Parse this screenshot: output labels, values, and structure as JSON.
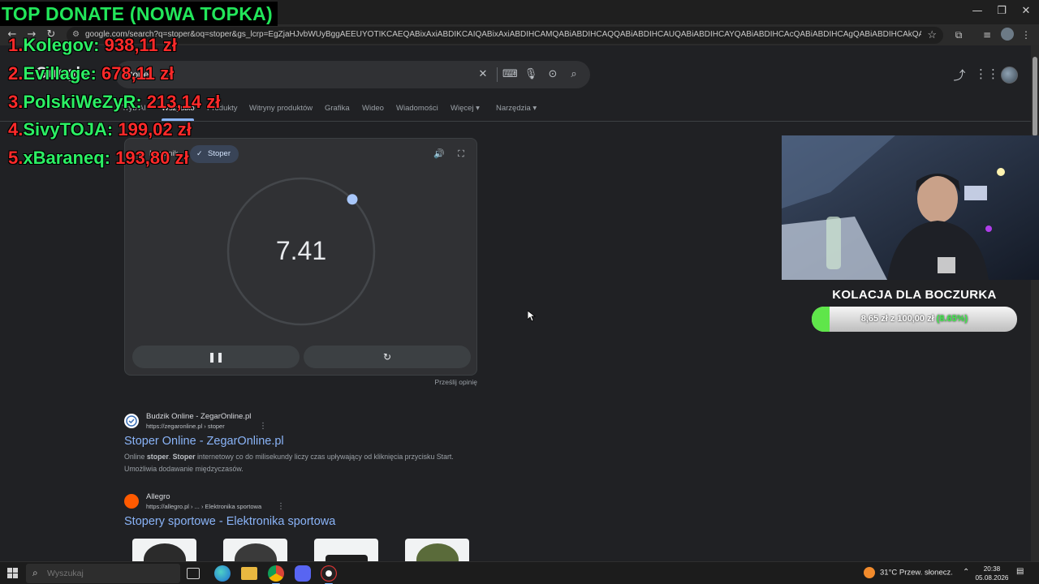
{
  "browser": {
    "url": "google.com/search?q=stoper&oq=stoper&gs_lcrp=EgZjaHJvbWUyBggAEEUYOTIKCAEQABixAxiABDIKCAIQABixAxiABDIHCAMQABiABDIHCAQQABiABDIHCAUQABiABDIHCAYQABiABDIHCAcQABiABDIHCAgQABiABDIHCAkQABiPAtIBBzYxOGowajeoAg..."
  },
  "google": {
    "logo_text": "Google",
    "search_value": "stoper",
    "tabs": [
      "Tryb AI",
      "Wszystko",
      "Produkty",
      "Witryny produktów",
      "Grafika",
      "Wideo",
      "Wiadomości",
      "Więcej ▾",
      "Narzędzia ▾"
    ],
    "stopwatch": {
      "chip_timer": "Minutnik",
      "chip_stopwatch": "Stoper",
      "time": "7.41",
      "feedback": "Prześlij opinię"
    },
    "results": [
      {
        "site": "Budzik Online - ZegarOnline.pl",
        "url": "https://zegaronline.pl › stoper",
        "title": "Stoper Online - ZegarOnline.pl",
        "snippet_a": "Online ",
        "snippet_b1": "stoper",
        "snippet_c": ". ",
        "snippet_b2": "Stoper",
        "snippet_d": " internetowy co do milisekundy liczy czas upływający od kliknięcia przycisku Start. Umożliwia dodawanie międzyczasów."
      },
      {
        "site": "Allegro",
        "url": "https://allegro.pl › ... › Elektronika sportowa",
        "title": "Stopery sportowe - Elektronika sportowa"
      }
    ]
  },
  "overlay": {
    "donate_title": "TOP DONATE (NOWA TOPKA)",
    "donors": [
      {
        "rank": "1.",
        "name": "Kolegov",
        "amount": "938,11 zł"
      },
      {
        "rank": "2.",
        "name": "Evillage",
        "amount": "678,11 zł"
      },
      {
        "rank": "3.",
        "name": "PolskiWeZyR",
        "amount": "213,14 zł"
      },
      {
        "rank": "4.",
        "name": "SivyTOJA",
        "amount": "199,02 zł"
      },
      {
        "rank": "5.",
        "name": "xBaraneq",
        "amount": "193,80 zł"
      }
    ],
    "goal": {
      "title": "KOLACJA DLA BOCZURKA",
      "amount_text": "8,65 zł z 100,00 zł",
      "percent_text": "(8.65%)",
      "fraction": 0.0865
    }
  },
  "taskbar": {
    "search_placeholder": "Wyszukaj",
    "weather": "31°C  Przew. słonecz.",
    "time": "20:38",
    "date": "05.08.2026"
  },
  "colors": {
    "page_bg": "#202124",
    "link_blue": "#8ab4f8",
    "donor_green": "#2cef64",
    "donor_red": "#ff2a2a",
    "goal_green": "#5fe64a"
  }
}
